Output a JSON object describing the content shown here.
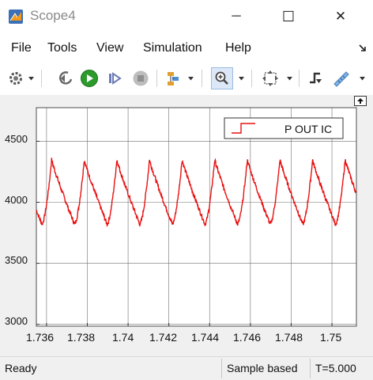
{
  "window": {
    "title": "Scope4",
    "minimize_glyph": "─",
    "maximize_glyph": "☐",
    "close_glyph": "✕"
  },
  "menu": {
    "items": [
      "File",
      "Tools",
      "View",
      "Simulation",
      "Help"
    ]
  },
  "toolbar": {
    "icons": [
      "settings-icon",
      "step-back-icon",
      "run-icon",
      "step-forward-icon",
      "stop-icon",
      "highlight-icon",
      "zoom-icon",
      "autoscale-icon",
      "triggers-icon",
      "measurements-icon"
    ]
  },
  "chart_data": {
    "type": "line",
    "title": "",
    "xlabel": "",
    "ylabel": "",
    "xlim": [
      1.7355,
      1.7512
    ],
    "ylim": [
      2985,
      4775
    ],
    "x_ticks": [
      "1.736",
      "1.738",
      "1.74",
      "1.742",
      "1.744",
      "1.746",
      "1.748",
      "1.75"
    ],
    "y_ticks": [
      "3000",
      "3500",
      "4000",
      "4500"
    ],
    "grid": true,
    "legend": {
      "placement": "top-right",
      "entries": [
        "P OUT IC"
      ]
    },
    "series": [
      {
        "name": "P OUT IC",
        "color": "#e81010",
        "period": 0.0016,
        "first_peak": 1.73625,
        "peak": 4350,
        "trough": 3820,
        "x_start": 1.7355,
        "x_end": 1.7512
      }
    ]
  },
  "status": {
    "ready": "Ready",
    "mode": "Sample based",
    "time": "T=5.000"
  }
}
